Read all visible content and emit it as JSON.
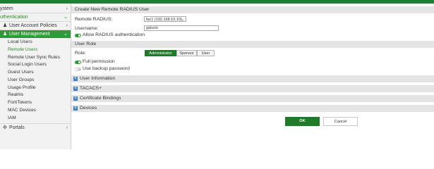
{
  "sidebar": {
    "system": "ystem",
    "authentication": "uthentication",
    "user_account_policies": "User Account Policies",
    "user_management": "User Management",
    "sub_items": [
      "Local Users",
      "Remote Users",
      "Remote User Sync Rules",
      "Social Login Users",
      "Guest Users",
      "User Groups",
      "Usage Profile",
      "Realms",
      "FortiTokens",
      "MAC Devices",
      "IAM"
    ],
    "selected_sub_item": "Remote Users",
    "portals": "Portals"
  },
  "form": {
    "title": "Create New Remote RADIUS User",
    "remote_radius_label": "Remote RADIUS:",
    "remote_radius_value": "fac1 (192.168.10.10)",
    "username_label": "Username:",
    "username_value": "gatuoo",
    "allow_radius_label": "Allow RADIUS authentication",
    "allow_radius_on": true
  },
  "user_role": {
    "title": "User Role",
    "role_label": "Role:",
    "roles": [
      "Administrator",
      "Sponsor",
      "User"
    ],
    "selected_role": "Administrator",
    "full_permission_label": "Full permission",
    "full_permission_on": true,
    "backup_password_label": "Use backup password",
    "backup_password_on": false
  },
  "collapsed_sections": [
    "User Information",
    "TACACS+",
    "Certificate Bindings",
    "Devices"
  ],
  "buttons": {
    "ok": "OK",
    "cancel": "Cancel"
  },
  "colors": {
    "brand_green": "#2f9a3a",
    "dark_green": "#1f7a2a",
    "plus_blue": "#3d7fc1"
  }
}
